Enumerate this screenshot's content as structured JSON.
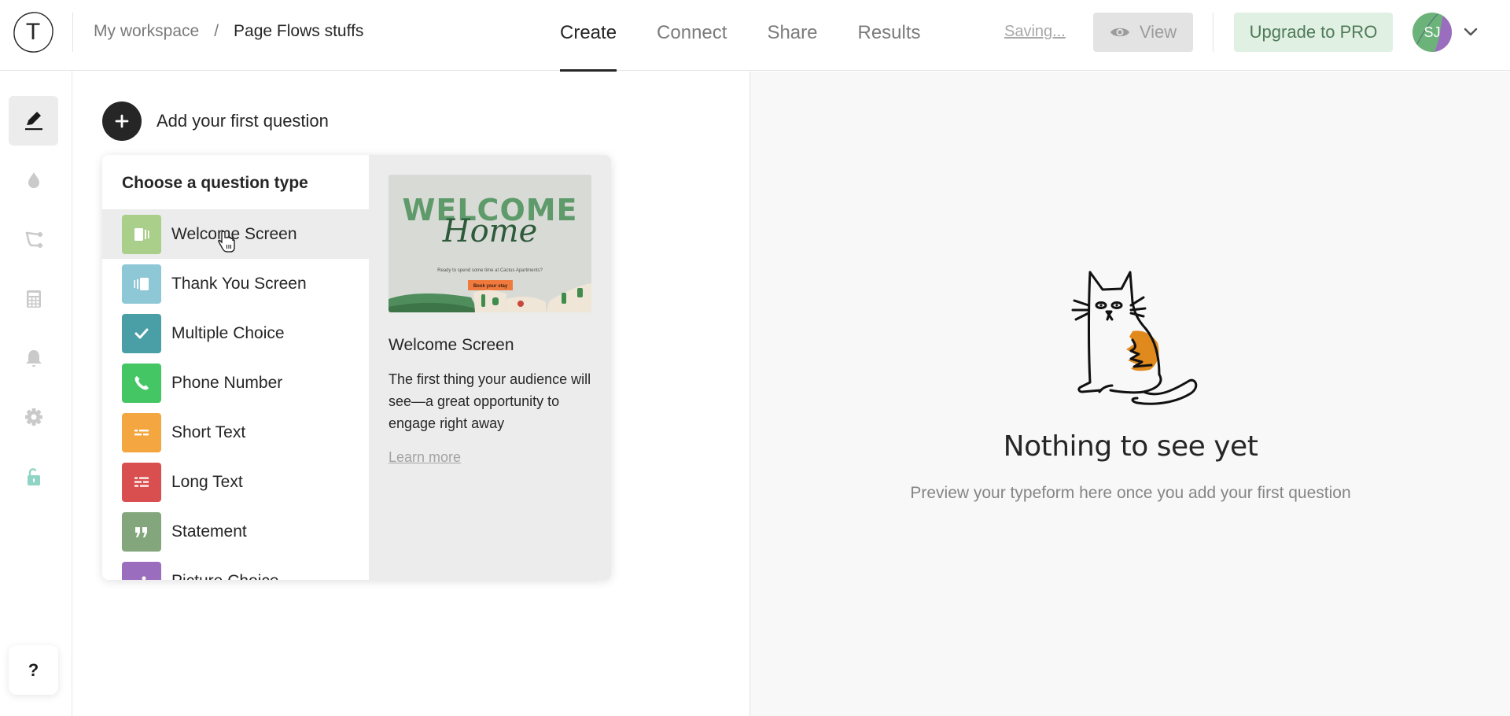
{
  "header": {
    "logo_letter": "T",
    "breadcrumb": {
      "workspace": "My workspace",
      "separator": "/",
      "page": "Page Flows stuffs"
    },
    "tabs": [
      {
        "label": "Create",
        "active": true
      },
      {
        "label": "Connect",
        "active": false
      },
      {
        "label": "Share",
        "active": false
      },
      {
        "label": "Results",
        "active": false
      }
    ],
    "saving_label": "Saving...",
    "view_label": "View",
    "upgrade_label": "Upgrade to PRO",
    "avatar_initials": "SJ"
  },
  "sidebar": {
    "items": [
      {
        "name": "create",
        "icon": "pencil-icon",
        "active": true
      },
      {
        "name": "design",
        "icon": "droplet-icon",
        "active": false
      },
      {
        "name": "logic",
        "icon": "branch-icon",
        "active": false
      },
      {
        "name": "calculator",
        "icon": "calculator-icon",
        "active": false
      },
      {
        "name": "notifications",
        "icon": "bell-icon",
        "active": false
      },
      {
        "name": "settings",
        "icon": "gear-icon",
        "active": false
      },
      {
        "name": "access",
        "icon": "unlock-icon",
        "active": false
      }
    ],
    "help_label": "?"
  },
  "builder": {
    "add_question_label": "Add your first question",
    "question_types_title": "Choose a question type",
    "question_types": [
      {
        "label": "Welcome Screen",
        "color": "#a9cf8a",
        "icon": "welcome-screen-icon"
      },
      {
        "label": "Thank You Screen",
        "color": "#8ec7d6",
        "icon": "thank-you-screen-icon"
      },
      {
        "label": "Multiple Choice",
        "color": "#4a9ea6",
        "icon": "check-icon"
      },
      {
        "label": "Phone Number",
        "color": "#45c665",
        "icon": "phone-icon"
      },
      {
        "label": "Short Text",
        "color": "#f4a640",
        "icon": "short-text-icon"
      },
      {
        "label": "Long Text",
        "color": "#d94f4f",
        "icon": "long-text-icon"
      },
      {
        "label": "Statement",
        "color": "#84a67d",
        "icon": "quote-icon"
      },
      {
        "label": "Picture Choice",
        "color": "#9b6dbf",
        "icon": "picture-choice-icon"
      }
    ],
    "preview": {
      "image_headline": "WELCOME",
      "image_script": "Home",
      "image_tagline": "Ready to spend some time at Cactus Apartments?",
      "image_button": "Book your stay",
      "title": "Welcome Screen",
      "description": "The first thing your audience will see—a great opportunity to engage right away",
      "learn_more": "Learn more"
    }
  },
  "preview_panel": {
    "title": "Nothing to see yet",
    "subtitle": "Preview your typeform here once you add your first question"
  }
}
